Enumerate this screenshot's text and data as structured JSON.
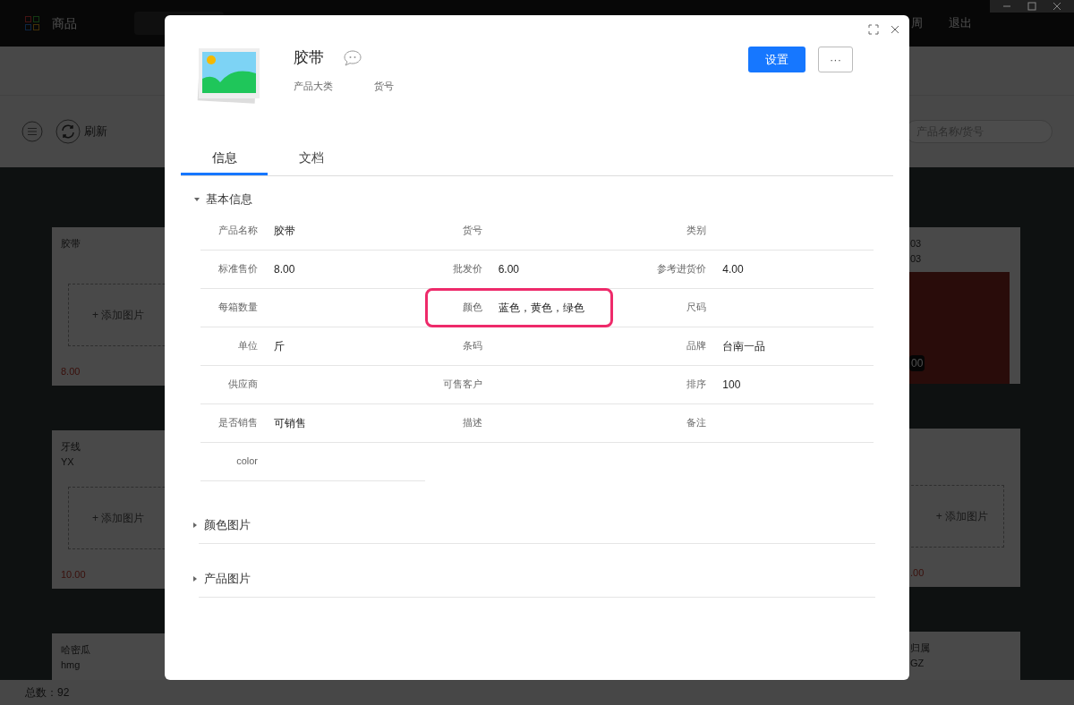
{
  "app": {
    "title": "商品",
    "nav_links": [
      "周",
      "退出"
    ],
    "toolbar": {
      "refresh": "刷新",
      "search_placeholder": "产品名称/货号"
    },
    "left_cards": [
      {
        "name": "胶带",
        "add_image": "+ 添加图片",
        "price": "8.00"
      },
      {
        "name": "牙线",
        "code": "YX",
        "add_image": "+ 添加图片",
        "price": "10.00"
      },
      {
        "name": "哈密瓜",
        "code": "hmg"
      }
    ],
    "right_cards": [
      {
        "name": "03",
        "code": "03",
        "kind": "photo",
        "price": "00"
      },
      {
        "kind": "empty",
        "add_image": "+ 添加图片",
        "price": ".00"
      },
      {
        "name": "归属",
        "code": "GZ",
        "kind": "text"
      }
    ],
    "status_bar": "总数：92"
  },
  "dialog": {
    "title": "胶带",
    "meta": [
      "产品大类",
      "货号"
    ],
    "buttons": {
      "primary": "设置",
      "more": "···"
    },
    "tabs": [
      {
        "label": "信息",
        "selected": true
      },
      {
        "label": "文档",
        "selected": false
      }
    ],
    "sections": [
      {
        "title": "基本信息",
        "expanded": true,
        "fields": [
          {
            "label": "产品名称",
            "value": "胶带",
            "highlighted": false
          },
          {
            "label": "货号",
            "highlighted": false
          },
          {
            "label": "类别",
            "highlighted": false
          },
          {
            "label": "标准售价",
            "value": "8.00",
            "highlighted": false
          },
          {
            "label": "批发价",
            "value": "6.00",
            "highlighted": false
          },
          {
            "label": "参考进货价",
            "value": "4.00",
            "highlighted": false
          },
          {
            "label": "每箱数量",
            "highlighted": false
          },
          {
            "label": "颜色",
            "value": "蓝色，黄色，绿色",
            "highlighted": true
          },
          {
            "label": "尺码",
            "highlighted": false
          },
          {
            "label": "单位",
            "value": "斤",
            "highlighted": false
          },
          {
            "label": "条码",
            "highlighted": false
          },
          {
            "label": "品牌",
            "value": "台南一品",
            "highlighted": false
          },
          {
            "label": "供应商",
            "highlighted": false
          },
          {
            "label": "可售客户",
            "highlighted": false
          },
          {
            "label": "排序",
            "value": "100",
            "highlighted": false
          },
          {
            "label": "是否销售",
            "value": "可销售",
            "highlighted": false
          },
          {
            "label": "描述",
            "highlighted": false
          },
          {
            "label": "备注",
            "highlighted": false
          },
          {
            "label": "color",
            "highlighted": false
          }
        ]
      },
      {
        "title": "颜色图片",
        "expanded": false
      },
      {
        "title": "产品图片",
        "expanded": false
      }
    ]
  }
}
